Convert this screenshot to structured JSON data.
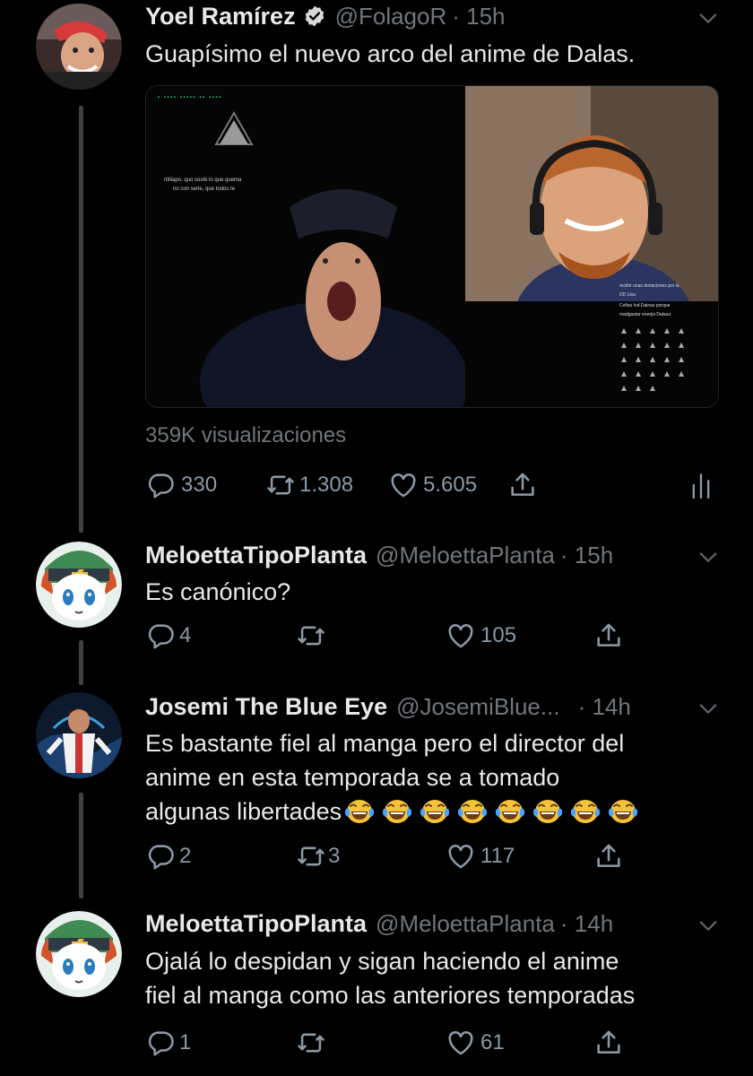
{
  "colors": {
    "background": "#000000",
    "text": "#e7e9ea",
    "muted": "#71767b",
    "verified": "#d9d9d9",
    "thread_line": "#3d4247"
  },
  "tweets": [
    {
      "name": "Yoel Ramírez",
      "verified": true,
      "handle": "@FolagoR",
      "time": "· 15h",
      "text_lines": [
        "Guapísimo el nuevo arco del anime de Dalas."
      ],
      "views": "359K visualizaciones",
      "replies": "330",
      "retweets": "1.308",
      "likes": "5.605",
      "media": {
        "overlay_lines": [
          "ritiliapo, quo sosté lo que quema",
          "no con serie, que todos te"
        ],
        "right_overlay_lines": [
          "recibir unas donaciones por la",
          "DD Lisa",
          "Cefias Ind Dainas porque",
          "madgastar enerjia Dalasa"
        ]
      }
    },
    {
      "name": "MeloettaTipoPlanta",
      "handle": "@MeloettaPlanta",
      "time": "· 15h",
      "text_lines": [
        "Es canónico?"
      ],
      "replies": "4",
      "retweets": "",
      "likes": "105"
    },
    {
      "name": "Josemi The Blue Eye",
      "handle": "@JosemiBlue...",
      "time": "· 14h",
      "text_lines": [
        "Es bastante fiel al manga pero el director del",
        "anime en esta temporada se a tomado",
        "algunas libertades"
      ],
      "emoji": "face-with-tears-of-joy x8",
      "replies": "2",
      "retweets": "3",
      "likes": "117"
    },
    {
      "name": "MeloettaTipoPlanta",
      "handle": "@MeloettaPlanta",
      "time": "· 14h",
      "text_lines": [
        "Ojalá lo despidan y sigan haciendo el anime",
        "fiel al manga como las anteriores temporadas"
      ],
      "replies": "1",
      "retweets": "",
      "likes": "61"
    }
  ]
}
